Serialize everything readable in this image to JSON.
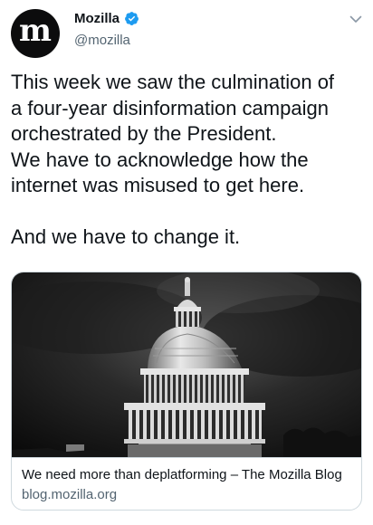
{
  "author": {
    "avatar_letter": "m",
    "display_name": "Mozilla",
    "handle": "@mozilla",
    "verified": true,
    "verified_color": "#1d9bf0"
  },
  "tweet": {
    "text": "This week we saw the culmination of\na four-year disinformation campaign\norchestrated by the President.\nWe have to acknowledge how the\ninternet was misused to get here.\n\nAnd we have to change it."
  },
  "link_card": {
    "image_subject": "US Capitol dome at night, black-and-white",
    "title": "We need more than deplatforming – The Mozilla Blog",
    "domain": "blog.mozilla.org"
  },
  "icons": {
    "verified": "verified-badge-icon",
    "menu": "chevron-down-icon"
  }
}
